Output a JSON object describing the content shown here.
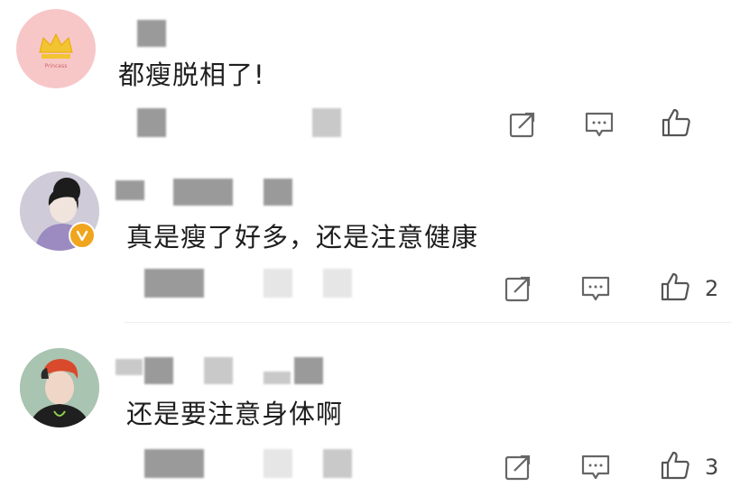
{
  "comments": [
    {
      "text": "都瘦脱相了!",
      "like_count": ""
    },
    {
      "text": "真是瘦了好多，还是注意健康",
      "like_count": "2"
    },
    {
      "text": "还是要注意身体啊",
      "like_count": "3"
    }
  ],
  "icons": {
    "share": "share-icon",
    "comment": "comment-icon",
    "like": "thumbs-up-icon",
    "verified": "verified-badge-icon"
  },
  "colors": {
    "avatar1_bg": "#f7c7c8",
    "crown": "#f2c431",
    "badge": "#f0a51e",
    "icon_stroke": "#666666"
  }
}
